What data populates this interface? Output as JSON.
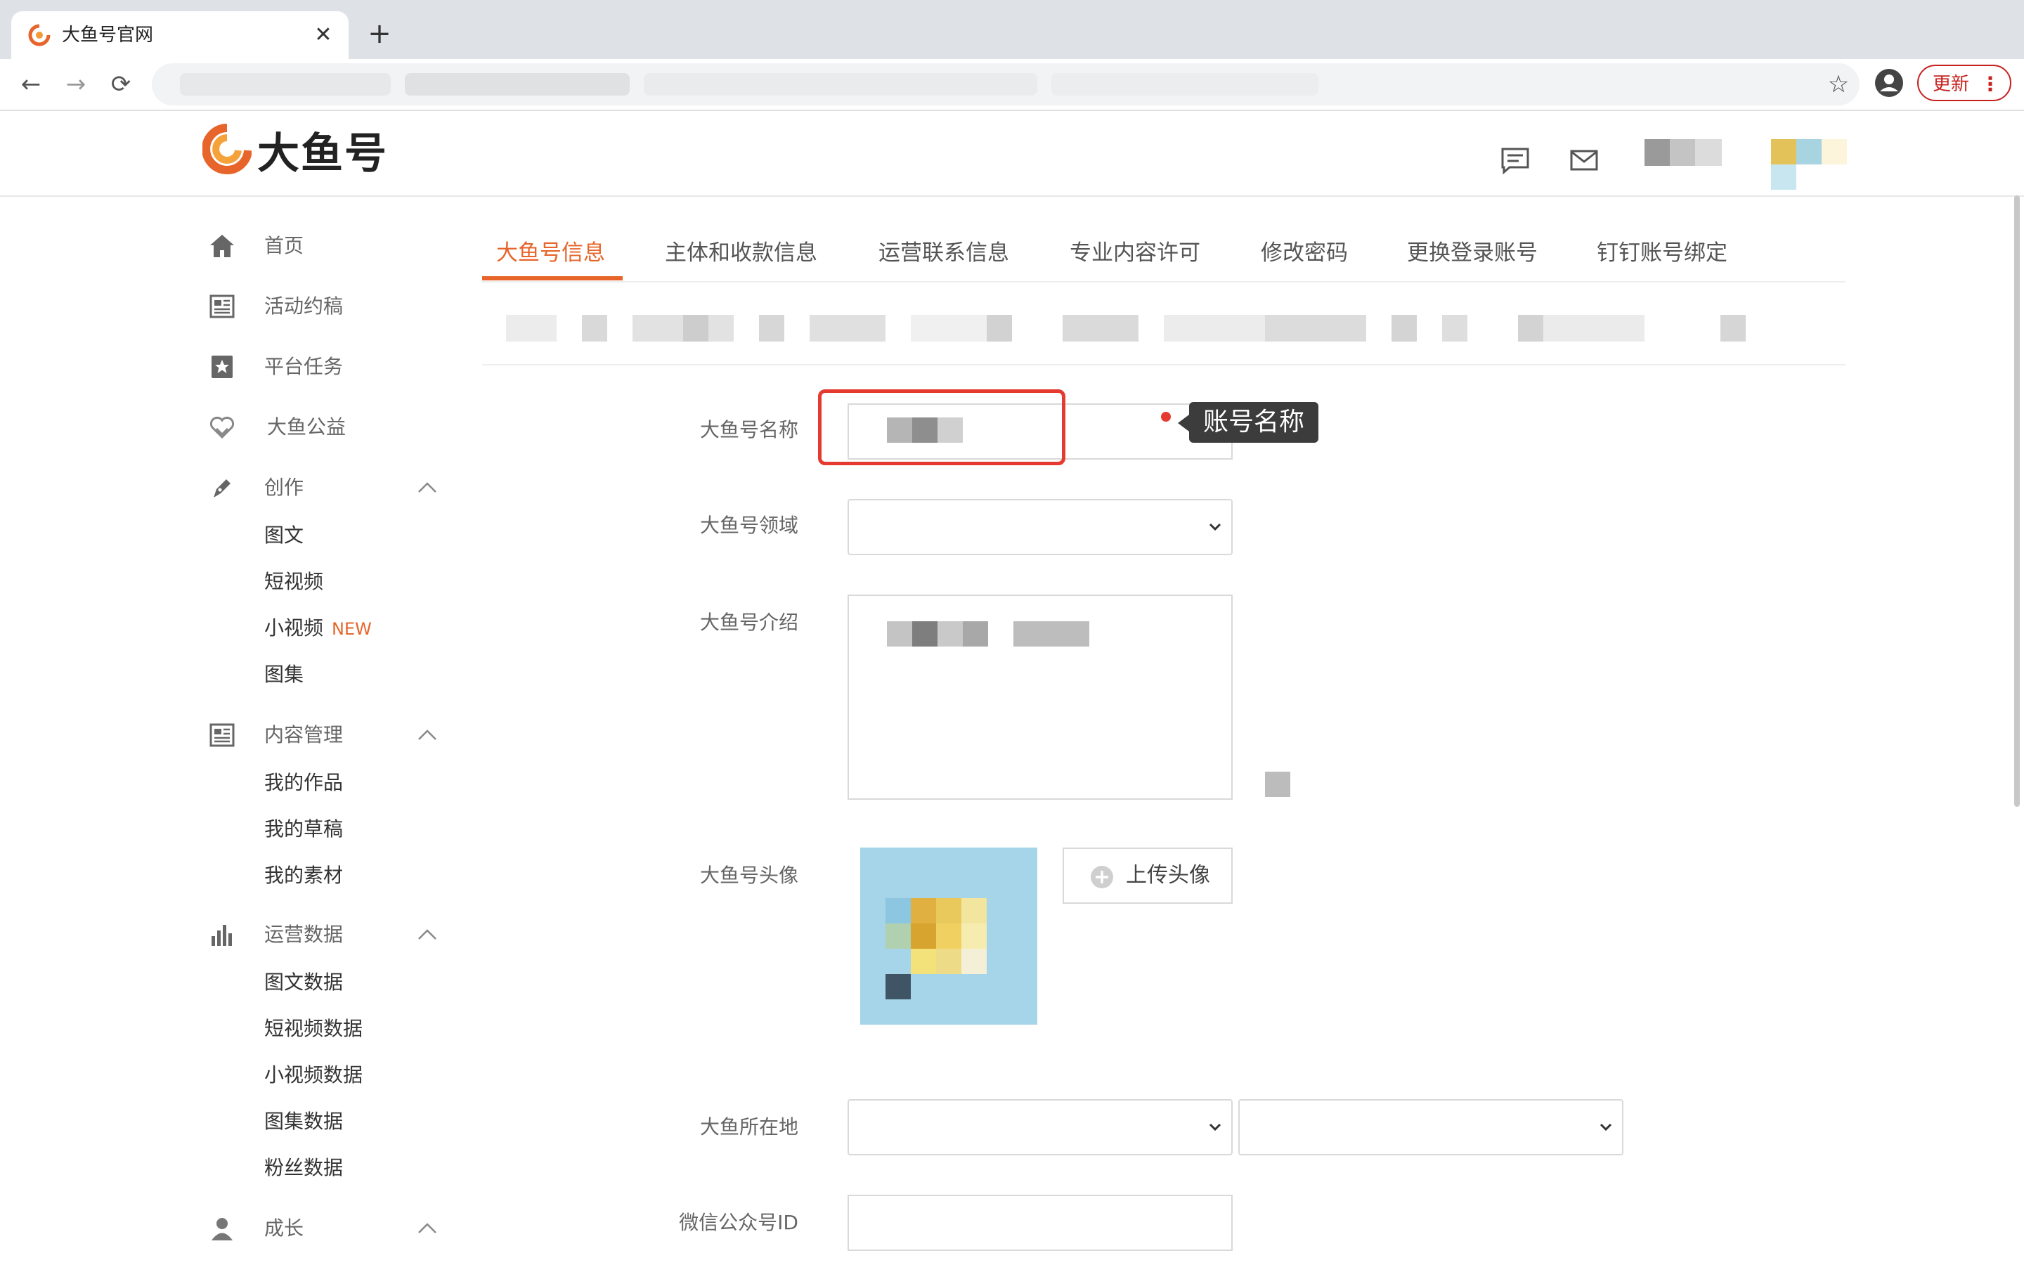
{
  "browser": {
    "tab_title": "大鱼号官网",
    "update_label": "更新"
  },
  "site": {
    "logo_text": "大鱼号"
  },
  "sidebar": {
    "items": [
      {
        "label": "首页",
        "icon": "home-icon"
      },
      {
        "label": "活动约稿",
        "icon": "newspaper-icon"
      },
      {
        "label": "平台任务",
        "icon": "star-bookmark-icon"
      },
      {
        "label": "大鱼公益",
        "icon": "heart-hands-icon"
      }
    ],
    "groups": [
      {
        "label": "创作",
        "icon": "pen-icon",
        "children": [
          "图文",
          "短视频",
          "小视频",
          "图集"
        ]
      },
      {
        "label": "内容管理",
        "icon": "content-list-icon",
        "children": [
          "我的作品",
          "我的草稿",
          "我的素材"
        ]
      },
      {
        "label": "运营数据",
        "icon": "bar-chart-icon",
        "children": [
          "图文数据",
          "短视频数据",
          "小视频数据",
          "图集数据",
          "粉丝数据"
        ]
      },
      {
        "label": "成长",
        "icon": "user-icon",
        "children": []
      }
    ],
    "new_badge": "NEW"
  },
  "tabs": [
    "大鱼号信息",
    "主体和收款信息",
    "运营联系信息",
    "专业内容许可",
    "修改密码",
    "更换登录账号",
    "钉钉账号绑定"
  ],
  "form": {
    "name_label": "大鱼号名称",
    "domain_label": "大鱼号领域",
    "intro_label": "大鱼号介绍",
    "avatar_label": "大鱼号头像",
    "upload_label": "上传头像",
    "location_label": "大鱼所在地",
    "wechat_label": "微信公众号ID"
  },
  "tooltip": {
    "text": "账号名称"
  },
  "colors": {
    "accent": "#e7652b",
    "highlight": "#e53a2f",
    "tooltip_bg": "#3c3c3c"
  }
}
